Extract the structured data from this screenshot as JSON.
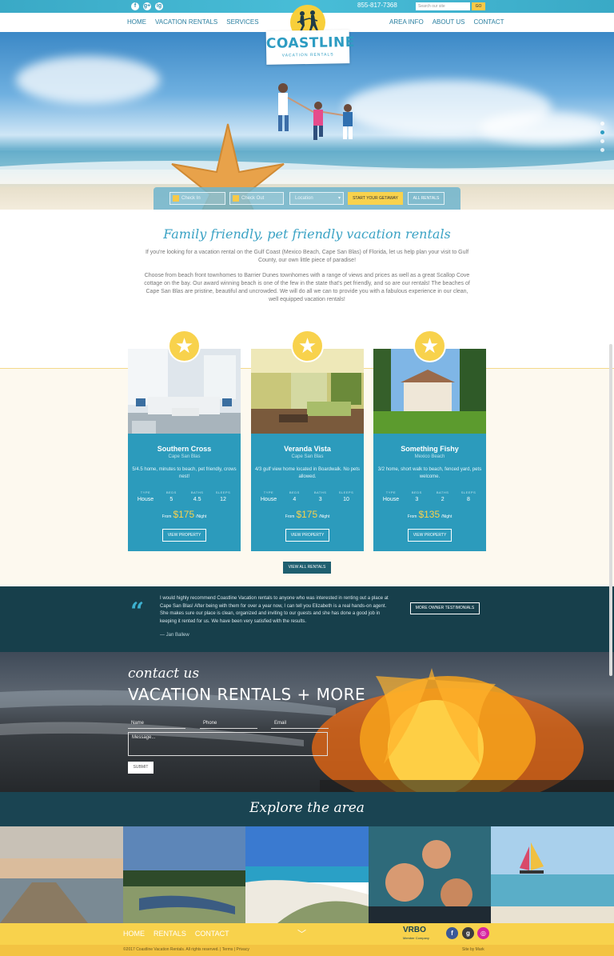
{
  "topbar": {
    "social": [
      "f",
      "g+",
      "ig"
    ],
    "phone": "855-817-7368",
    "search_placeholder": "Search our site",
    "go_label": "GO"
  },
  "nav": {
    "left": [
      "HOME",
      "VACATION RENTALS",
      "SERVICES"
    ],
    "right": [
      "AREA INFO",
      "ABOUT US",
      "CONTACT"
    ]
  },
  "logo": {
    "brand": "COASTLINE",
    "sub": "VACATION RENTALS"
  },
  "search": {
    "checkin_placeholder": "Check In",
    "checkout_placeholder": "Check Out",
    "location_placeholder": "Location",
    "start_label": "START YOUR GETAWAY",
    "all_label": "ALL RENTALS"
  },
  "intro": {
    "title": "Family friendly, pet friendly vacation rentals",
    "p1": "If you're looking for a vacation rental on the Gulf Coast (Mexico Beach, Cape San Blas) of Florida, let us help plan your visit to Gulf County, our own little piece of paradise!",
    "p2": "Choose from beach front townhomes to Barrier Dunes townhomes with a range of views and prices as well as a great Scallop Cove cottage on the bay. Our award winning beach is one of the few in the state that's pet friendly, and so are our rentals! The beaches of Cape San Blas are pristine, beautiful and uncrowded. We will do all we can to provide you with a fabulous experience in our clean, well equipped vacation rentals!"
  },
  "spec_headers": [
    "TYPE",
    "BEDS",
    "BATHS",
    "SLEEPS"
  ],
  "price_prefix": "From",
  "price_suffix": "/Night",
  "view_property_label": "VIEW PROPERTY",
  "cards": [
    {
      "name": "Southern Cross",
      "location": "Cape San Blas",
      "desc": "5/4.5 home, minutes to beach, pet friendly, crows nest!",
      "type": "House",
      "beds": "5",
      "baths": "4.5",
      "sleeps": "12",
      "price": "$175"
    },
    {
      "name": "Veranda Vista",
      "location": "Cape San Blas",
      "desc": "4/3 gulf view home located in Boardwalk. No pets allowed.",
      "type": "House",
      "beds": "4",
      "baths": "3",
      "sleeps": "10",
      "price": "$175"
    },
    {
      "name": "Something Fishy",
      "location": "Mexico Beach",
      "desc": "3/2 home, short walk to beach, fenced yard, pets welcome.",
      "type": "House",
      "beds": "3",
      "baths": "2",
      "sleeps": "8",
      "price": "$135"
    }
  ],
  "view_all_label": "VIEW ALL RENTALS",
  "testimonial": {
    "quote_mark": "“",
    "text": "I would highly recommend Coastline Vacation rentals to anyone who was interested in renting out a place at Cape San Blas! After being with them for over a year now, I can tell you Elizabeth is a real hands-on agent. She makes sure our place is clean, organized and inviting to our guests and she has done a good job in keeping it rented for us. We have been very satisfied with the results.",
    "author": "— Jan Ballew",
    "more_label": "MORE OWNER TESTIMONIALS"
  },
  "contact": {
    "label": "contact us",
    "heading": "VACATION RENTALS + MORE",
    "name_placeholder": "Name",
    "phone_placeholder": "Phone",
    "email_placeholder": "Email",
    "message_placeholder": "Message...",
    "submit_label": "SUBMIT"
  },
  "explore": {
    "title": "Explore the area"
  },
  "footer": {
    "nav": [
      "HOME",
      "RENTALS",
      "CONTACT"
    ],
    "vrbo": "VRBO",
    "vrbo_sub": "Member Company",
    "copyright": "©2017 Coastline Vacation Rentals. All rights reserved. | Terms | Privacy",
    "site_by": "Site by Mark"
  },
  "colors": {
    "accent": "#2c9bbc",
    "yellow": "#f8d24c",
    "dark": "#173f4b"
  }
}
